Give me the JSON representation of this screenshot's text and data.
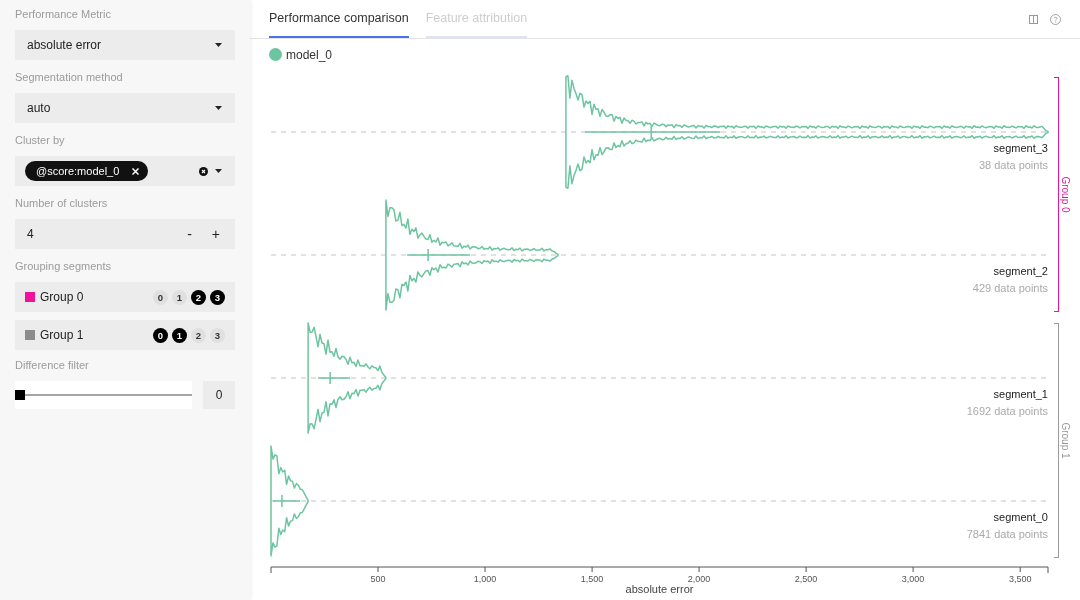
{
  "sidebar": {
    "metric": {
      "label": "Performance Metric",
      "value": "absolute error"
    },
    "segmentation": {
      "label": "Segmentation method",
      "value": "auto"
    },
    "cluster_by": {
      "label": "Cluster by",
      "tags": [
        "@score:model_0"
      ]
    },
    "cluster_count": {
      "label": "Number of clusters",
      "value": "4",
      "decrement": "-",
      "increment": "+"
    },
    "grouping": {
      "label": "Grouping segments",
      "groups": [
        {
          "name": "Group 0",
          "color": "#f0129b",
          "segments": [
            {
              "label": "0",
              "selected": false
            },
            {
              "label": "1",
              "selected": false
            },
            {
              "label": "2",
              "selected": true
            },
            {
              "label": "3",
              "selected": true
            }
          ]
        },
        {
          "name": "Group 1",
          "color": "#8a8d8a",
          "segments": [
            {
              "label": "0",
              "selected": true
            },
            {
              "label": "1",
              "selected": true
            },
            {
              "label": "2",
              "selected": false
            },
            {
              "label": "3",
              "selected": false
            }
          ]
        }
      ]
    },
    "difference_filter": {
      "label": "Difference filter",
      "level": 0,
      "value": "0"
    }
  },
  "main": {
    "tabs": [
      {
        "label": "Performance comparison",
        "selected": true
      },
      {
        "label": "Feature attribution",
        "selected": false
      }
    ],
    "plot": {
      "legend": [
        {
          "name": "model_0",
          "color": "#6cc5a0"
        }
      ],
      "segments": [
        {
          "name": "segment_3",
          "count": "38 data points"
        },
        {
          "name": "segment_2",
          "count": "429 data points"
        },
        {
          "name": "segment_1",
          "count": "1692 data points"
        },
        {
          "name": "segment_0",
          "count": "7841 data points"
        }
      ],
      "groups": [
        {
          "label": "Group 0",
          "color": "#e5169a"
        },
        {
          "label": "Group 1",
          "color": "#9a9a9a"
        }
      ],
      "x_axis": {
        "title": "absolute error",
        "ticks": [
          "500",
          "1,000",
          "1,500",
          "2,000",
          "2,500",
          "3,000",
          "3,500"
        ]
      }
    }
  }
}
